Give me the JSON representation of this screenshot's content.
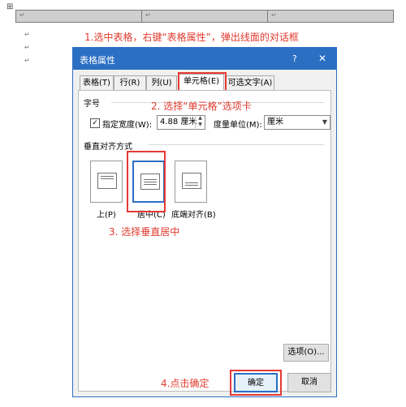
{
  "doc": {
    "handle_symbol": "⊞",
    "paragraph_mark": "↵",
    "annotation1": "1.选中表格，右键“表格属性”，弹出线面的对话框"
  },
  "dialog": {
    "title": "表格属性",
    "help": "?",
    "close": "✕",
    "tabs": [
      "表格(T)",
      "行(R)",
      "列(U)",
      "单元格(E)",
      "可选文字(A)"
    ],
    "section_size": "字号",
    "specify_width_label": "指定宽度(W):",
    "width_value": "4.88 厘米",
    "unit_label": "度量单位(M):",
    "unit_value": "厘米",
    "section_valign": "垂直对齐方式",
    "align_top": "上(P)",
    "align_center": "居中(C)",
    "align_bottom": "底端对齐(B)",
    "options_button": "选项(O)...",
    "ok_button": "确定",
    "cancel_button": "取消"
  },
  "annotations": {
    "step2": "2. 选择“单元格”选项卡",
    "step3": "3.  选择垂直居中",
    "step4": "4.点击确定"
  }
}
